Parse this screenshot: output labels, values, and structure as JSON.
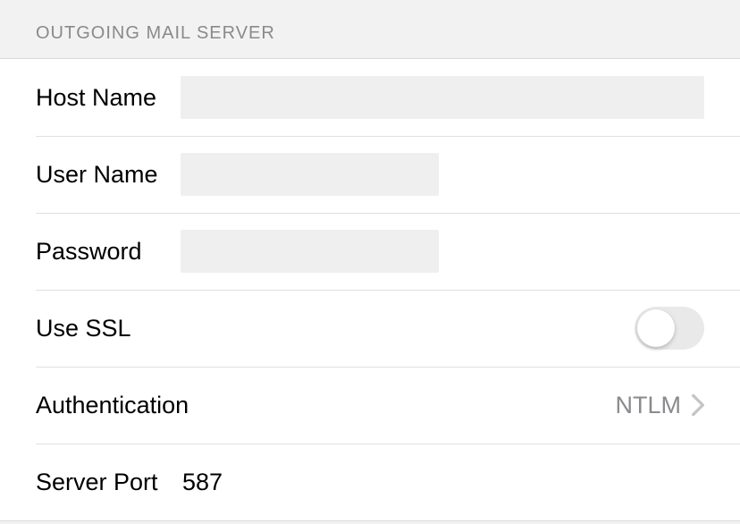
{
  "section": {
    "title": "OUTGOING MAIL SERVER"
  },
  "fields": {
    "host_name_label": "Host Name",
    "user_name_label": "User Name",
    "password_label": "Password",
    "use_ssl_label": "Use SSL",
    "authentication_label": "Authentication",
    "authentication_value": "NTLM",
    "server_port_label": "Server Port",
    "server_port_value": "587"
  },
  "states": {
    "use_ssl_on": false
  }
}
